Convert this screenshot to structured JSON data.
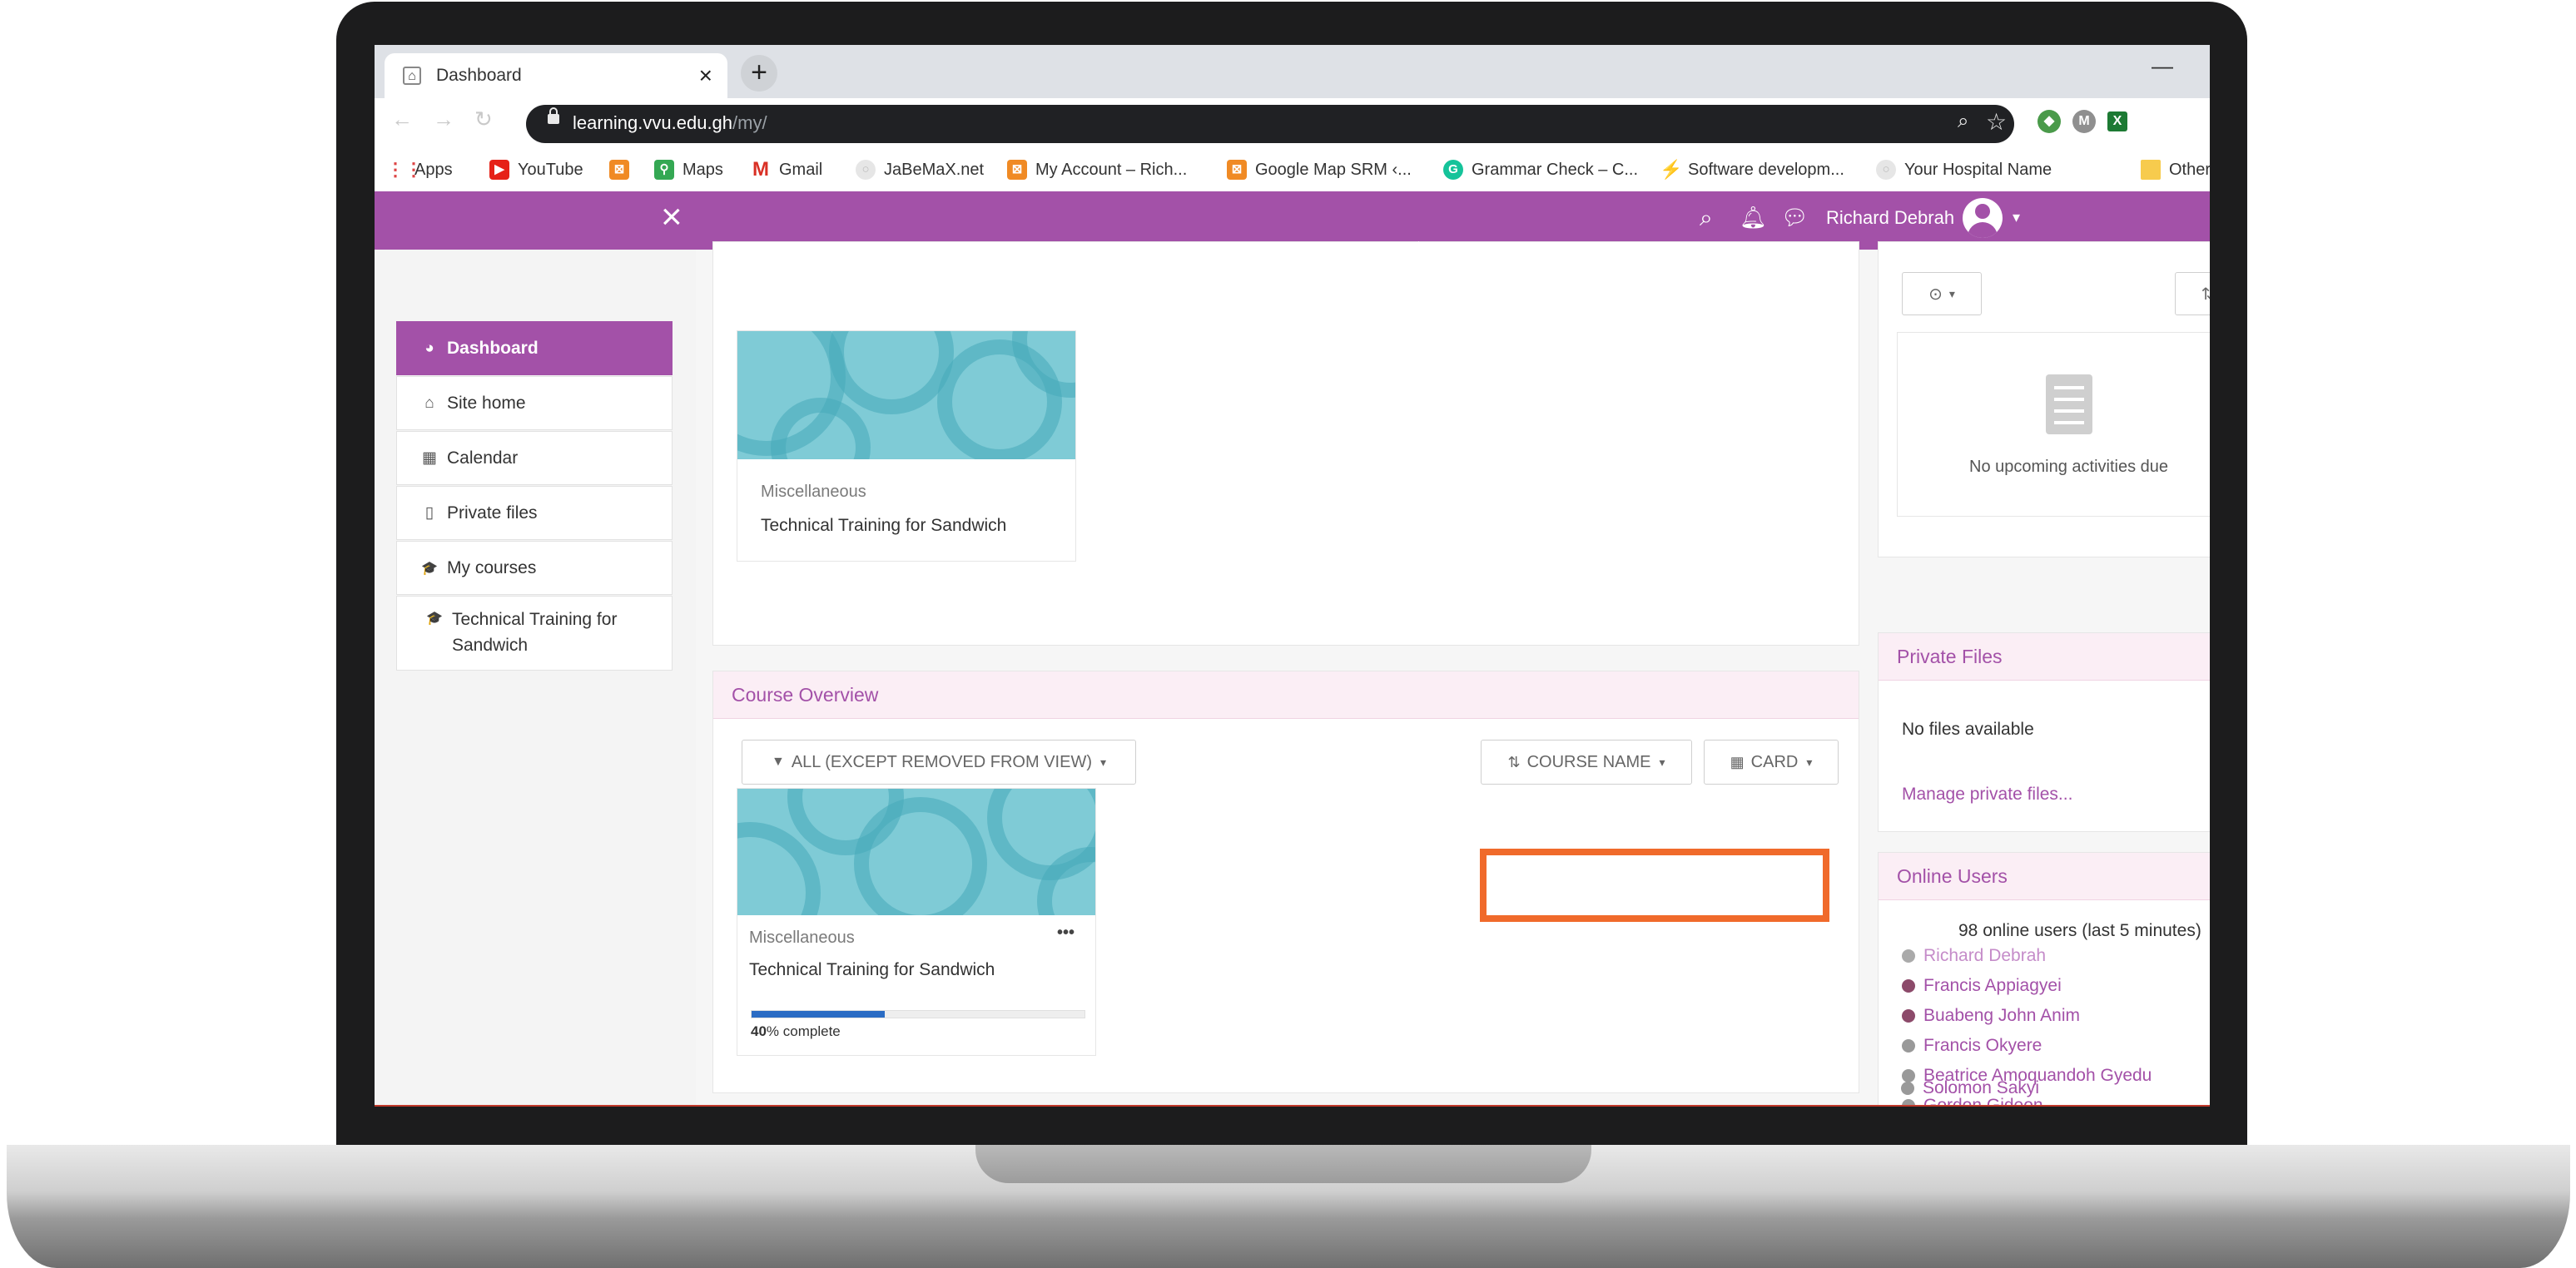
{
  "browser": {
    "tab_title": "Dashboard",
    "tab_close": "×",
    "new_tab": "+",
    "minimize": "—",
    "url_host": "learning.vvu.edu.gh",
    "url_path": "/my/",
    "bookmarks": [
      {
        "label": "Apps",
        "icon": "apps-grid-icon"
      },
      {
        "label": "YouTube",
        "icon": "youtube-icon"
      },
      {
        "label": "",
        "icon": "bookmark-icon"
      },
      {
        "label": "Maps",
        "icon": "maps-icon"
      },
      {
        "label": "Gmail",
        "icon": "gmail-icon"
      },
      {
        "label": "JaBeMaX.net",
        "icon": "globe-icon"
      },
      {
        "label": "My Account – Rich...",
        "icon": "bookmark-icon"
      },
      {
        "label": "Google Map SRM ‹...",
        "icon": "bookmark-icon"
      },
      {
        "label": "Grammar Check – C...",
        "icon": "grammarly-icon"
      },
      {
        "label": "Software developm...",
        "icon": "bolt-icon"
      },
      {
        "label": "Your Hospital Name",
        "icon": "globe-icon"
      },
      {
        "label": "Other",
        "icon": "folder-icon"
      }
    ]
  },
  "navbar": {
    "user_name": "Richard Debrah",
    "close_icon": "×"
  },
  "sidebar": {
    "items": [
      {
        "label": "Dashboard",
        "icon": "dashboard-icon",
        "glyph": "◕"
      },
      {
        "label": "Site home",
        "icon": "home-icon",
        "glyph": "⌂"
      },
      {
        "label": "Calendar",
        "icon": "calendar-icon",
        "glyph": "▦"
      },
      {
        "label": "Private files",
        "icon": "file-icon",
        "glyph": "▯"
      },
      {
        "label": "My courses",
        "icon": "graduation-cap-icon",
        "glyph": "🎓"
      },
      {
        "label": "Technical Training for Sandwich",
        "icon": "graduation-cap-icon",
        "glyph": "🎓"
      }
    ]
  },
  "recent_course": {
    "category": "Miscellaneous",
    "name": "Technical Training for Sandwich"
  },
  "course_overview": {
    "title": "Course Overview",
    "filter_label": "ALL (EXCEPT REMOVED FROM VIEW)",
    "sort_label": "COURSE NAME",
    "view_label": "CARD",
    "card": {
      "category": "Miscellaneous",
      "name": "Technical Training for Sandwich",
      "menu": "•••",
      "progress_percent": 40,
      "progress_num": "40",
      "progress_suffix": "% complete"
    }
  },
  "timeline": {
    "empty_text": "No upcoming activities due"
  },
  "private_files": {
    "title": "Private Files",
    "empty_text": "No files available",
    "manage_link": "Manage private files..."
  },
  "online_users": {
    "title": "Online Users",
    "summary": "98 online users (last 5 minutes)",
    "users": [
      "Richard Debrah",
      "Francis Appiagyei",
      "Buabeng John Anim",
      "Francis Okyere",
      "Beatrice Amoquandoh Gyedu",
      "Gordon Gideon",
      "Solomon Sakyi"
    ]
  },
  "colors": {
    "brand": "#a351a8",
    "highlight": "#f06a2b",
    "progress": "#2b6cc4",
    "course_image": "#7fcbd6"
  }
}
